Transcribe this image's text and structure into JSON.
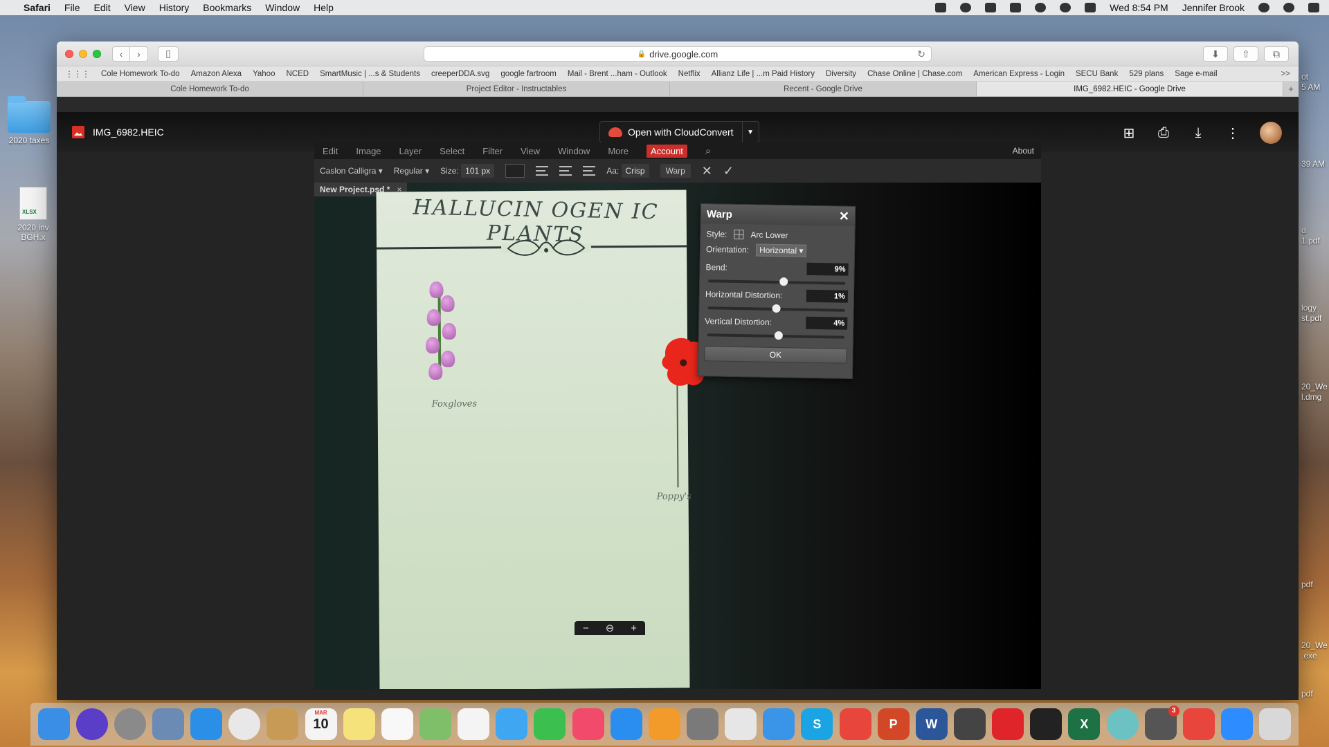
{
  "menubar": {
    "app_name": "Safari",
    "menus": [
      "File",
      "Edit",
      "View",
      "History",
      "Bookmarks",
      "Window",
      "Help"
    ],
    "clock": "Wed 8:54 PM",
    "user": "Jennifer Brook"
  },
  "desktop": {
    "items": [
      {
        "label": "2020 taxes"
      },
      {
        "label": "2020 inv BGH.x",
        "badge": "XLSX"
      }
    ],
    "right_labels": [
      "ot\n5 AM",
      "39 AM",
      "d\n1.pdf",
      "logy\nst.pdf",
      "20_We\nl.dmg",
      "pdf",
      "20_We\n.exe",
      "pdf"
    ]
  },
  "browser": {
    "address": "drive.google.com",
    "bookmarks": [
      "Cole Homework To-do",
      "Amazon Alexa",
      "Yahoo",
      "NCED",
      "SmartMusic | ...s & Students",
      "creeperDDA.svg",
      "google fartroom",
      "Mail - Brent ...ham - Outlook",
      "Netflix",
      "Allianz Life | ...m Paid History",
      "Diversity",
      "Chase Online | Chase.com",
      "American Express - Login",
      "SECU Bank",
      "529 plans",
      "Sage e-mail"
    ],
    "bookmarks_more": ">>",
    "tabs": [
      {
        "label": "Cole Homework To-do",
        "active": false
      },
      {
        "label": "Project Editor - Instructables",
        "active": false
      },
      {
        "label": "Recent - Google Drive",
        "active": false
      },
      {
        "label": "IMG_6982.HEIC - Google Drive",
        "active": true
      }
    ]
  },
  "viewer": {
    "file_name": "IMG_6982.HEIC",
    "open_with_label": "Open with CloudConvert"
  },
  "photo": {
    "editor_menu": [
      "Edit",
      "Image",
      "Layer",
      "Select",
      "Filter",
      "View",
      "Window",
      "More"
    ],
    "account_label": "Account",
    "about_label": "About",
    "font_name": "Caslon Calligra",
    "font_style": "Regular",
    "size_label": "Size:",
    "size_value": "101 px",
    "aa_label": "Aa:",
    "aa_value": "Crisp",
    "warp_button": "Warp",
    "doc_tab": "New Project.psd *",
    "poster_title": "HALLUCIN OGEN IC PLANTS",
    "flower_labels": [
      "Foxgloves",
      "Poppy's"
    ],
    "warp_dialog": {
      "title": "Warp",
      "style_label": "Style:",
      "style_value": "Arc Lower",
      "orientation_label": "Orientation:",
      "orientation_value": "Horizontal",
      "params": [
        {
          "label": "Bend:",
          "value": "9%",
          "fraction": 0.55
        },
        {
          "label": "Horizontal Distortion:",
          "value": "1%",
          "fraction": 0.5
        },
        {
          "label": "Vertical Distortion:",
          "value": "4%",
          "fraction": 0.52
        }
      ],
      "ok_label": "OK"
    }
  },
  "dock": {
    "apps": [
      {
        "name": "finder",
        "color": "#3a8ee6"
      },
      {
        "name": "siri",
        "color": "#5a3ec8"
      },
      {
        "name": "launchpad",
        "color": "#8a8a8a"
      },
      {
        "name": "preview",
        "color": "#6b8bb5"
      },
      {
        "name": "safari",
        "color": "#2b8fe8"
      },
      {
        "name": "chrome",
        "color": "#e8e8e8"
      },
      {
        "name": "notefile",
        "color": "#c79b55"
      },
      {
        "name": "calendar",
        "color": "#f4f4f4",
        "text": "10",
        "subtext": "MAR"
      },
      {
        "name": "notes",
        "color": "#f6e27a"
      },
      {
        "name": "reminders",
        "color": "#f8f8f8"
      },
      {
        "name": "maps",
        "color": "#7fbf6a"
      },
      {
        "name": "photos",
        "color": "#f4f4f4"
      },
      {
        "name": "messages",
        "color": "#3fa7f2"
      },
      {
        "name": "facetime",
        "color": "#3bbf4f"
      },
      {
        "name": "music",
        "color": "#f24a6a"
      },
      {
        "name": "app-store",
        "color": "#2a8ef0"
      },
      {
        "name": "books",
        "color": "#f29a2a"
      },
      {
        "name": "system-preferences",
        "color": "#7a7a7a"
      },
      {
        "name": "roblox",
        "color": "#e6e6e6"
      },
      {
        "name": "migration",
        "color": "#3a94e8"
      },
      {
        "name": "skype",
        "color": "#1ba4e4",
        "text": "S"
      },
      {
        "name": "pdf-expert",
        "color": "#e8453c"
      },
      {
        "name": "powerpoint",
        "color": "#d24726",
        "text": "P"
      },
      {
        "name": "word",
        "color": "#2b579a",
        "text": "W"
      },
      {
        "name": "vpn",
        "color": "#444444"
      },
      {
        "name": "acrobat",
        "color": "#e0252a"
      },
      {
        "name": "acrobat-reader",
        "color": "#222222"
      },
      {
        "name": "excel",
        "color": "#1e7145",
        "text": "X"
      },
      {
        "name": "quicktime",
        "color": "#6cc2c2"
      },
      {
        "name": "printer",
        "color": "#555555",
        "badge": "3"
      },
      {
        "name": "anydesk",
        "color": "#e8453c"
      },
      {
        "name": "zoom",
        "color": "#2d8cff"
      },
      {
        "name": "trash",
        "color": "#d8d8d8"
      }
    ]
  }
}
